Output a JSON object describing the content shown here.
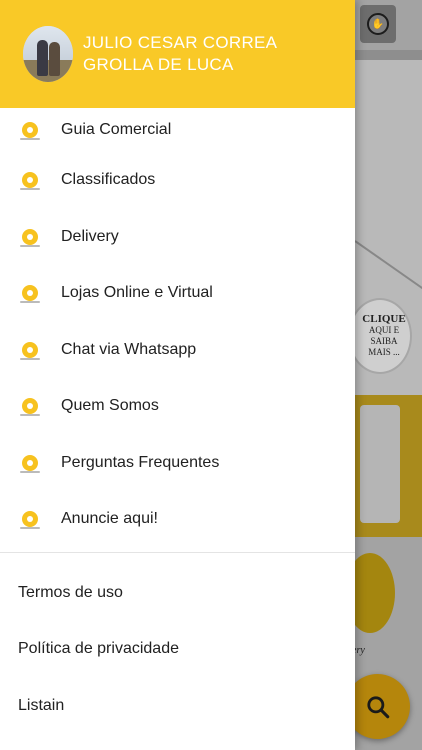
{
  "user": {
    "name_line1": "JULIO CESAR CORREA",
    "name_line2": "GROLLA DE LUCA"
  },
  "drawer_menu": [
    {
      "label": "Guia Comercial",
      "icon": "store-icon"
    },
    {
      "label": "Classificados",
      "icon": "tag-icon"
    },
    {
      "label": "Delivery",
      "icon": "delivery-icon"
    },
    {
      "label": "Lojas Online e Virtual",
      "icon": "cart-icon"
    },
    {
      "label": "Chat via Whatsapp",
      "icon": "whatsapp-icon"
    },
    {
      "label": "Quem Somos",
      "icon": "info-icon"
    },
    {
      "label": "Perguntas Frequentes",
      "icon": "question-icon"
    },
    {
      "label": "Anuncie aqui!",
      "icon": "megaphone-icon"
    }
  ],
  "secondary_menu": [
    {
      "label": "Termos de uso"
    },
    {
      "label": "Política de privacidade"
    },
    {
      "label": "Listain"
    }
  ],
  "background": {
    "banner_text_1": "CLIQUE",
    "banner_text_2": "AQUI E SAIBA",
    "banner_text_3": "MAIS ...",
    "circle_label": "ery"
  },
  "colors": {
    "accent": "#f9c927",
    "drawer_bg": "#ffffff",
    "text": "#212121"
  }
}
